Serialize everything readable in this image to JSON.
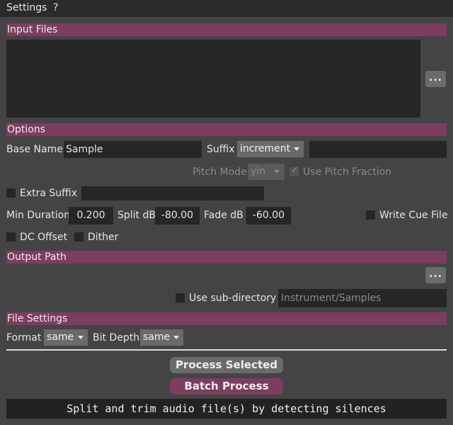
{
  "menubar": {
    "settings": "Settings",
    "help": "?"
  },
  "sections": {
    "input_files": "Input Files",
    "options": "Options",
    "output_path": "Output Path",
    "file_settings": "File Settings"
  },
  "input_files": {
    "browse_label": "..."
  },
  "options": {
    "base_name_label": "Base Name",
    "base_name_value": "Sample",
    "suffix_label": "Suffix",
    "suffix_value": "increment",
    "suffix_extra_value": "",
    "pitch_mode_label": "Pitch Mode",
    "pitch_mode_value": "yin",
    "use_pitch_fraction_label": "Use Pitch Fraction",
    "extra_suffix_label": "Extra Suffix",
    "extra_suffix_value": "",
    "min_duration_label": "Min Duration",
    "min_duration_value": "0.200",
    "split_db_label": "Split dB",
    "split_db_value": "-80.00",
    "fade_db_label": "Fade dB",
    "fade_db_value": "-60.00",
    "write_cue_label": "Write Cue File",
    "dc_offset_label": "DC Offset",
    "dither_label": "Dither"
  },
  "output_path": {
    "browse_label": "...",
    "use_subdir_label": "Use sub-directory",
    "subdir_placeholder": "Instrument/Samples"
  },
  "file_settings": {
    "format_label": "Format",
    "format_value": "same",
    "bit_depth_label": "Bit Depth",
    "bit_depth_value": "same"
  },
  "actions": {
    "process_selected": "Process Selected",
    "batch_process": "Batch Process"
  },
  "footer": {
    "status": "Split and trim audio file(s) by detecting silences"
  },
  "colors": {
    "section_header": "#7d3d5f",
    "batch_button": "#7d3d5f",
    "process_button": "#6b6b6b"
  }
}
